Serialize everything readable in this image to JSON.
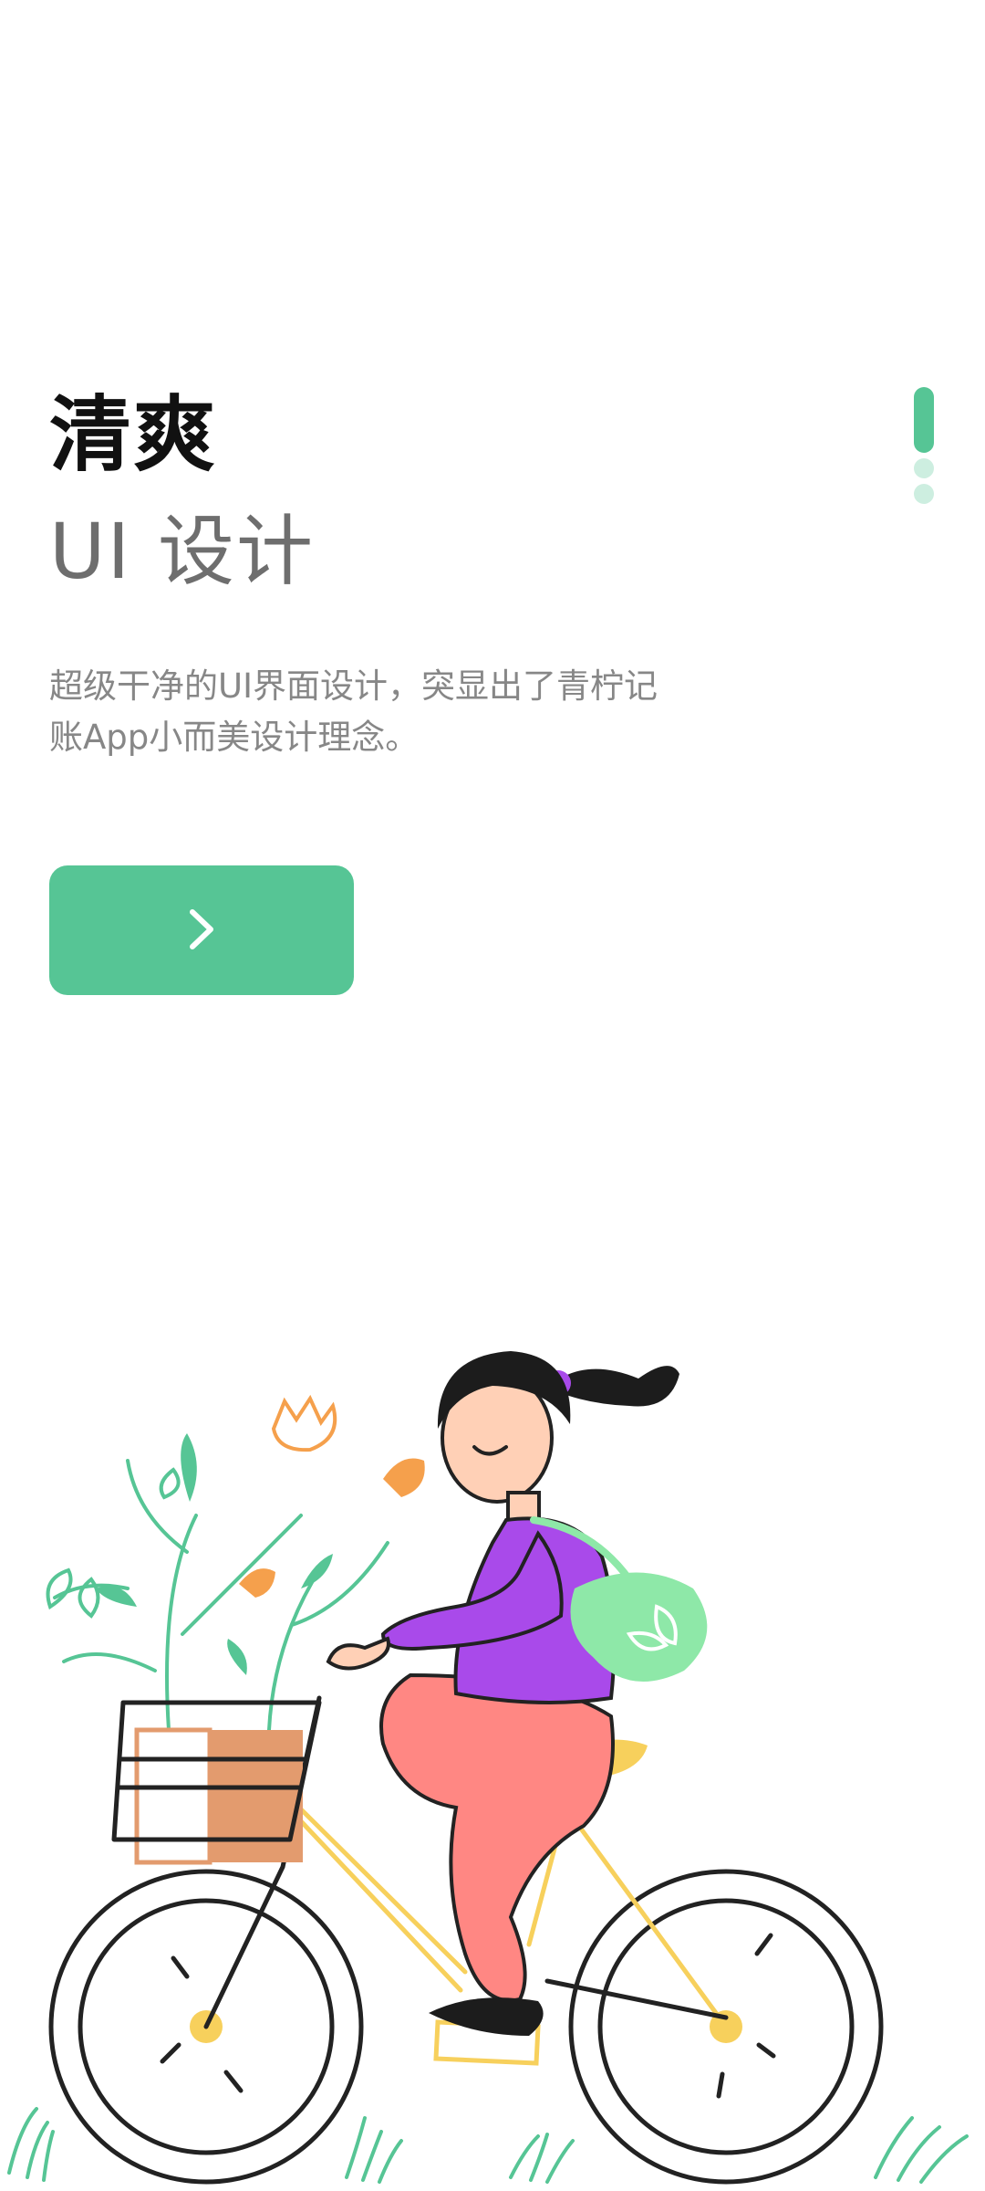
{
  "onboarding": {
    "title": "清爽",
    "subtitle": "UI 设计",
    "description": "超级干净的UI界面设计，突显出了青柠记账App小而美设计理念。",
    "next_icon": "chevron-right-icon"
  },
  "pager": {
    "total": 3,
    "current": 1
  },
  "colors": {
    "accent": "#56c595",
    "dot_inactive": "#cdeee0",
    "title": "#111111",
    "subtitle": "#6e6e6e",
    "description": "#878787"
  },
  "illustration": {
    "subject": "woman riding bicycle with plants in basket"
  }
}
